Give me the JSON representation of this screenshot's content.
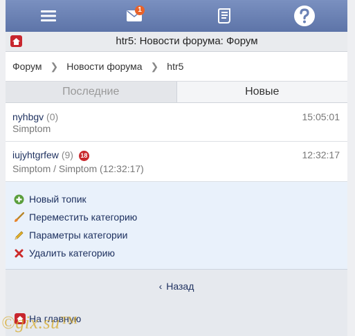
{
  "toolbar": {
    "mail_badge": "1"
  },
  "titlebar": {
    "title": "htr5: Новости форума: Форум"
  },
  "breadcrumb": [
    "Форум",
    "Новости форума",
    "htr5"
  ],
  "tabs": [
    {
      "label": "Последние",
      "active": false
    },
    {
      "label": "Новые",
      "active": true
    }
  ],
  "topics": [
    {
      "name": "nyhbgv",
      "count": "(0)",
      "new_badge": "",
      "time": "15:05:01",
      "author": "Simptom"
    },
    {
      "name": "iujyhtgrfew",
      "count": "(9)",
      "new_badge": "18",
      "time": "12:32:17",
      "author": "Simptom / Simptom (12:32:17)"
    }
  ],
  "actions": {
    "new_topic": "Новый топик",
    "move_category": "Переместить категорию",
    "category_params": "Параметры категории",
    "delete_category": "Удалить категорию"
  },
  "back_label": "Назад",
  "home_label": "На главную",
  "watermark": "©gix.su™",
  "colors": {
    "toolbar": "#6a81b5",
    "accent_red": "#c8262e",
    "badge_orange": "#e8622a",
    "link": "#1c2f5e",
    "actions_bg": "#e9f1fb"
  }
}
